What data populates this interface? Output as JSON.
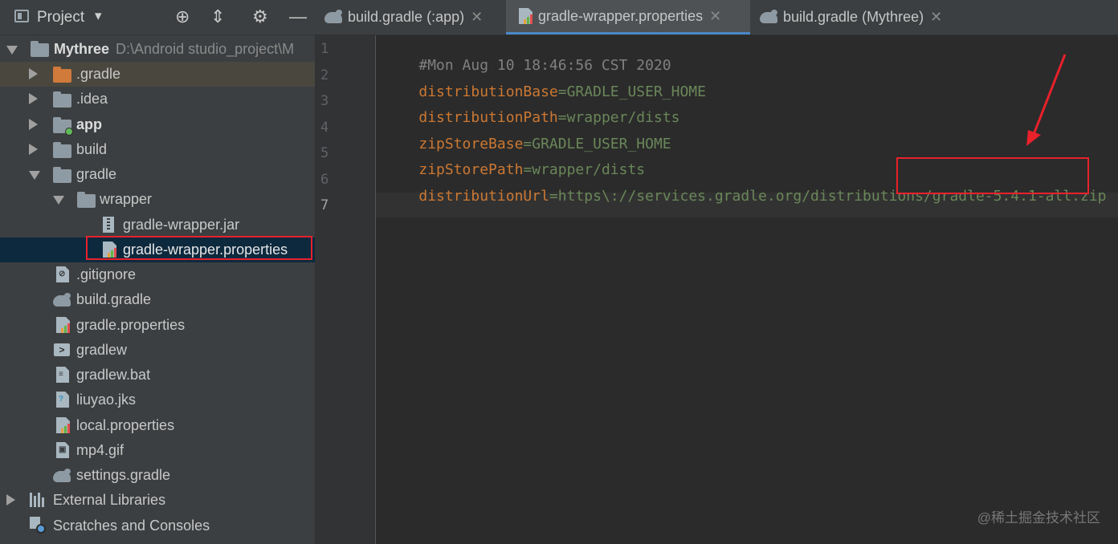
{
  "project_panel": {
    "title": "Project",
    "dropdown": "▾"
  },
  "tabs": [
    {
      "label": "build.gradle (:app)",
      "icon": "gradle-icon",
      "active": false
    },
    {
      "label": "gradle-wrapper.properties",
      "icon": "properties-file-icon",
      "active": true
    },
    {
      "label": "build.gradle (Mythree)",
      "icon": "gradle-icon",
      "active": false
    }
  ],
  "tab_close": "✕",
  "tree": {
    "root_name": "Mythree",
    "root_path": "D:\\Android studio_project\\M",
    "items": [
      {
        "label": ".gradle"
      },
      {
        "label": ".idea"
      },
      {
        "label": "app"
      },
      {
        "label": "build"
      },
      {
        "label": "gradle"
      },
      {
        "label": "wrapper"
      },
      {
        "label": "gradle-wrapper.jar"
      },
      {
        "label": "gradle-wrapper.properties"
      },
      {
        "label": ".gitignore"
      },
      {
        "label": "build.gradle"
      },
      {
        "label": "gradle.properties"
      },
      {
        "label": "gradlew"
      },
      {
        "label": "gradlew.bat"
      },
      {
        "label": "liuyao.jks"
      },
      {
        "label": "local.properties"
      },
      {
        "label": "mp4.gif"
      },
      {
        "label": "settings.gradle"
      },
      {
        "label": "External Libraries"
      },
      {
        "label": "Scratches and Consoles"
      }
    ]
  },
  "editor": {
    "line_numbers": [
      "1",
      "2",
      "3",
      "4",
      "5",
      "6",
      "7"
    ],
    "lines": [
      {
        "comment": "#Mon Aug 10 18:46:56 CST 2020"
      },
      {
        "key": "distributionBase",
        "value": "GRADLE_USER_HOME"
      },
      {
        "key": "distributionPath",
        "value": "wrapper/dists"
      },
      {
        "key": "zipStoreBase",
        "value": "GRADLE_USER_HOME"
      },
      {
        "key": "zipStorePath",
        "value": "wrapper/dists"
      },
      {
        "key": "distributionUrl",
        "value_prefix": "https\\://services.gradle.org/distributions/",
        "value_highlight": "gradle-5.4.1-all.zip"
      }
    ],
    "eq": "="
  },
  "watermark": "@稀土掘金技术社区",
  "colors": {
    "annotation": "#e8212b",
    "key": "#cc7832",
    "value": "#6a8759",
    "comment": "#808080",
    "selection": "#0d293e",
    "tab_accent": "#4a88c7"
  }
}
